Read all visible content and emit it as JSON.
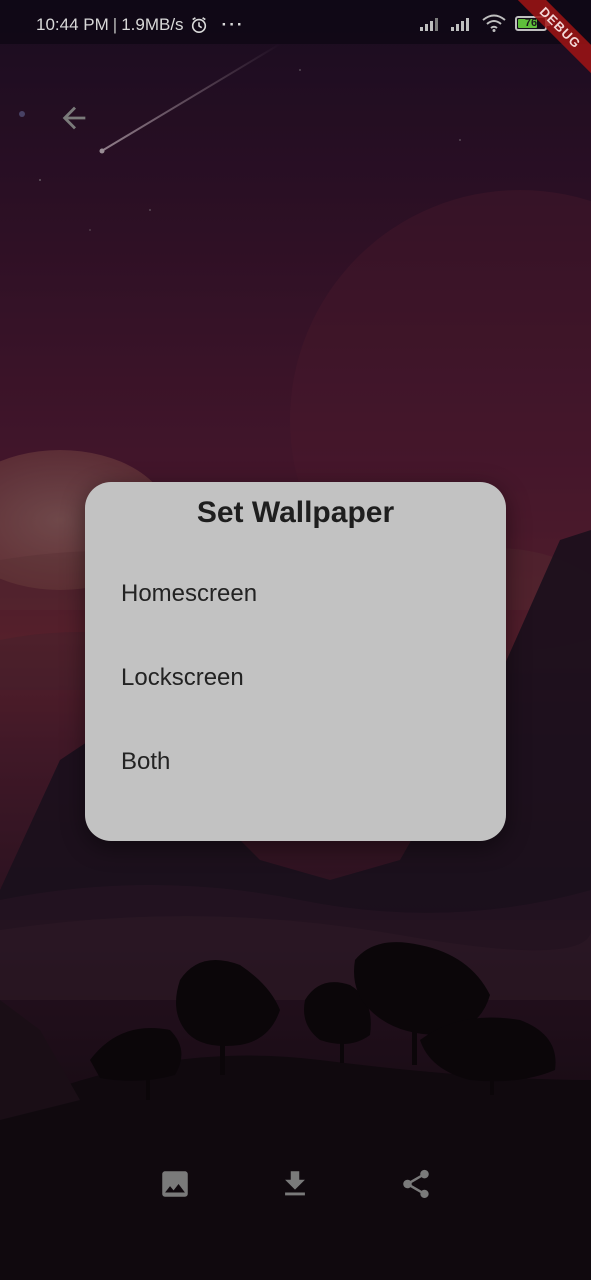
{
  "status_bar": {
    "time": "10:44 PM",
    "separator": "|",
    "network_speed": "1.9MB/s",
    "more": "···",
    "battery_level": "76",
    "battery_fraction": 0.76
  },
  "debug_banner": {
    "label": "DEBUG"
  },
  "dialog": {
    "title": "Set Wallpaper",
    "options": [
      {
        "label": "Homescreen"
      },
      {
        "label": "Lockscreen"
      },
      {
        "label": "Both"
      }
    ]
  },
  "icons": {
    "back": "arrow-left-icon",
    "alarm": "alarm-clock-icon",
    "signal": "cellular-signal-icon",
    "wifi": "wifi-icon",
    "battery": "battery-icon",
    "image": "image-icon",
    "download": "download-icon",
    "share": "share-icon"
  },
  "colors": {
    "dialog_bg": "#c2c2c2",
    "dialog_text": "#232323",
    "icon_gray": "#7a7a7a",
    "battery_green": "#5fbf3b",
    "debug_red": "#a01414"
  }
}
